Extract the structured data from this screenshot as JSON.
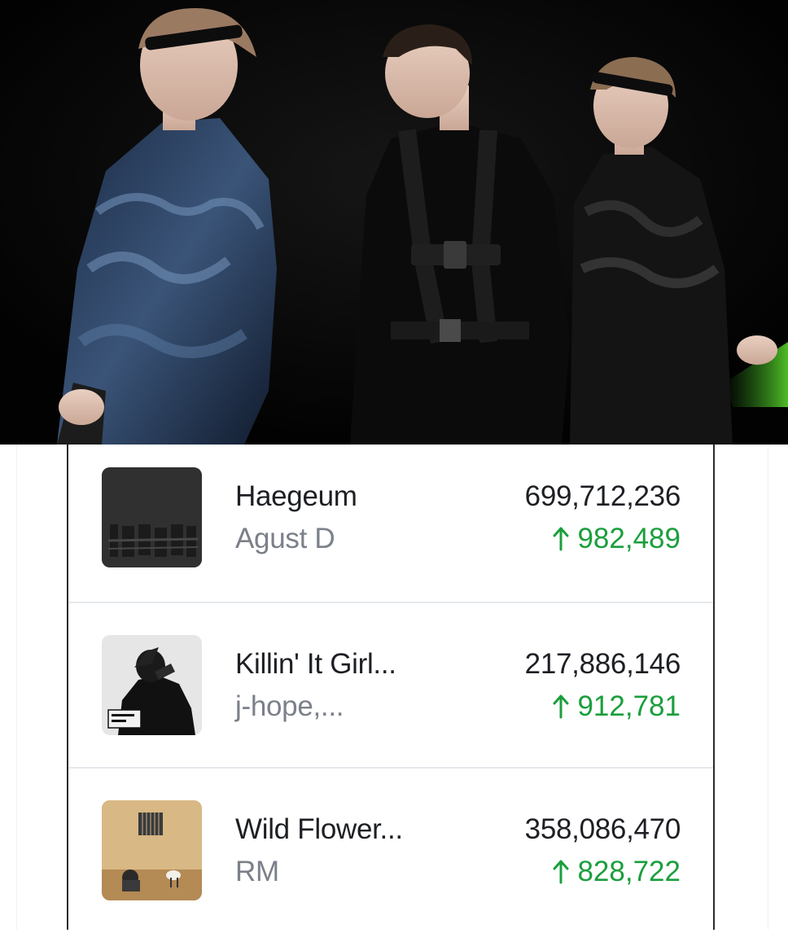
{
  "accent_color": "#1a9f3c",
  "tracks": [
    {
      "title": "Haegeum",
      "artist": "Agust D",
      "total_streams": "699,712,236",
      "daily_gain": "982,489",
      "cover_icon": "album-cover-dday",
      "trend_icon": "arrow-up-icon"
    },
    {
      "title": "Killin' It Girl...",
      "artist": "j-hope,...",
      "total_streams": "217,886,146",
      "daily_gain": "912,781",
      "cover_icon": "album-cover-killin-it-girl",
      "trend_icon": "arrow-up-icon"
    },
    {
      "title": "Wild Flower...",
      "artist": "RM",
      "total_streams": "358,086,470",
      "daily_gain": "828,722",
      "cover_icon": "album-cover-indigo",
      "trend_icon": "arrow-up-icon"
    }
  ]
}
